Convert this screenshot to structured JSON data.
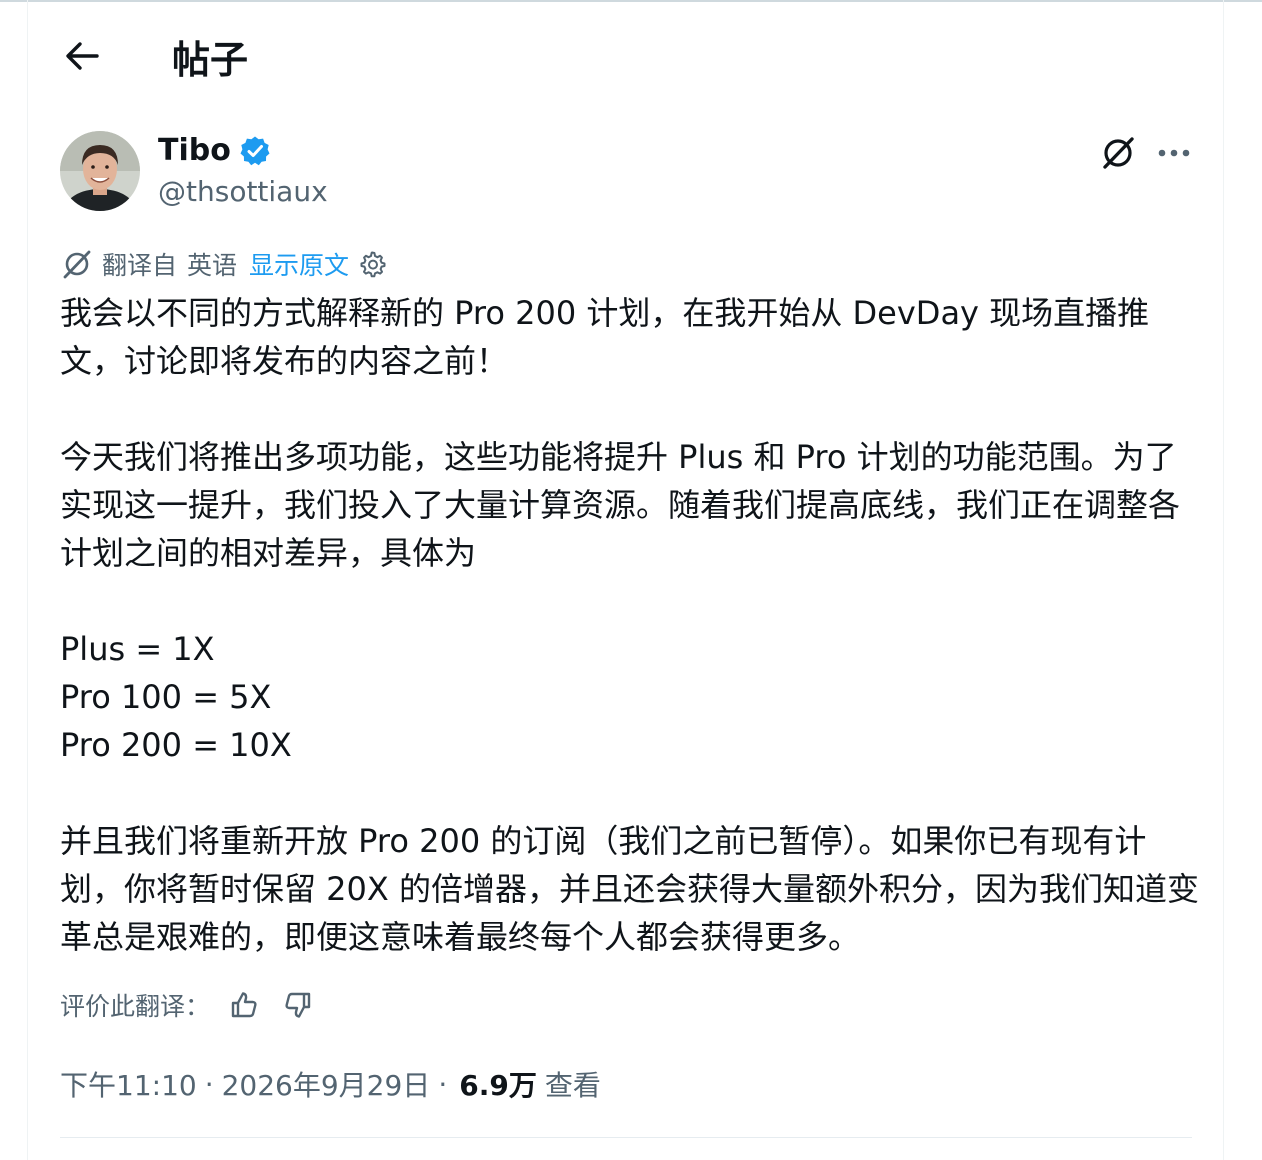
{
  "header": {
    "title": "帖子"
  },
  "author": {
    "name": "Tibo",
    "handle": "@thsottiaux",
    "verified": true
  },
  "translation": {
    "label": "翻译自",
    "language": "英语",
    "show_original": "显示原文"
  },
  "tweet": {
    "paragraphs": [
      "我会以不同的方式解释新的 Pro 200 计划，在我开始从 DevDay 现场直播推文，讨论即将发布的内容之前！",
      "今天我们将推出多项功能，这些功能将提升 Plus 和 Pro 计划的功能范围。为了实现这一提升，我们投入了大量计算资源。随着我们提高底线，我们正在调整各计划之间的相对差异，具体为",
      "Plus = 1X",
      "Pro 100 = 5X",
      "Pro 200 = 10X",
      "并且我们将重新开放 Pro 200 的订阅（我们之前已暂停）。如果你已有现有计划，你将暂时保留 20X 的倍增器，并且还会获得大量额外积分，因为我们知道变革总是艰难的，即便这意味着最终每个人都会获得更多。"
    ]
  },
  "rating": {
    "label": "评价此翻译："
  },
  "meta": {
    "time": "下午11:10",
    "date": "2026年9月29日",
    "views": "6.9万",
    "views_label": "查看",
    "separator": "·"
  },
  "colors": {
    "accent": "#1d9bf0",
    "text": "#0f1419",
    "secondary": "#536471"
  },
  "icons": {
    "back": "arrow-left-icon",
    "verified": "verified-badge-icon",
    "grok": "grok-icon",
    "more": "more-icon",
    "translate": "translate-icon",
    "settings": "gear-icon",
    "thumb_up": "thumbs-up-icon",
    "thumb_down": "thumbs-down-icon"
  }
}
